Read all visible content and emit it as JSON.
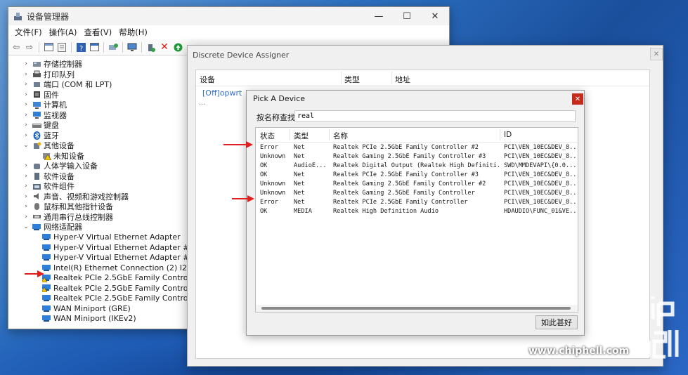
{
  "device_manager": {
    "title": "设备管理器",
    "menu": [
      "文件(F)",
      "操作(A)",
      "查看(V)",
      "帮助(H)"
    ],
    "tree": [
      {
        "label": "存储控制器",
        "arrow": ">",
        "level": 1,
        "icon": "storage-icon"
      },
      {
        "label": "打印队列",
        "arrow": ">",
        "level": 1,
        "icon": "printer-icon"
      },
      {
        "label": "端口 (COM 和 LPT)",
        "arrow": ">",
        "level": 1,
        "icon": "port-icon"
      },
      {
        "label": "固件",
        "arrow": ">",
        "level": 1,
        "icon": "firmware-icon"
      },
      {
        "label": "计算机",
        "arrow": ">",
        "level": 1,
        "icon": "computer-icon"
      },
      {
        "label": "监视器",
        "arrow": ">",
        "level": 1,
        "icon": "monitor-icon"
      },
      {
        "label": "键盘",
        "arrow": ">",
        "level": 1,
        "icon": "keyboard-icon"
      },
      {
        "label": "蓝牙",
        "arrow": ">",
        "level": 1,
        "icon": "bluetooth-icon"
      },
      {
        "label": "其他设备",
        "arrow": "v",
        "level": 1,
        "icon": "other-devices-icon"
      },
      {
        "label": "未知设备",
        "arrow": "",
        "level": 2,
        "icon": "unknown-device-warning-icon"
      },
      {
        "label": "人体学输入设备",
        "arrow": ">",
        "level": 1,
        "icon": "hid-icon"
      },
      {
        "label": "软件设备",
        "arrow": ">",
        "level": 1,
        "icon": "software-device-icon"
      },
      {
        "label": "软件组件",
        "arrow": ">",
        "level": 1,
        "icon": "software-component-icon"
      },
      {
        "label": "声音、视频和游戏控制器",
        "arrow": ">",
        "level": 1,
        "icon": "sound-icon"
      },
      {
        "label": "鼠标和其他指针设备",
        "arrow": ">",
        "level": 1,
        "icon": "mouse-icon"
      },
      {
        "label": "通用串行总线控制器",
        "arrow": ">",
        "level": 1,
        "icon": "usb-icon"
      },
      {
        "label": "网络适配器",
        "arrow": "v",
        "level": 1,
        "icon": "network-adapter-icon"
      },
      {
        "label": "Hyper-V Virtual Ethernet Adapter",
        "arrow": "",
        "level": 2,
        "icon": "network-adapter-icon"
      },
      {
        "label": "Hyper-V Virtual Ethernet Adapter #2",
        "arrow": "",
        "level": 2,
        "icon": "network-adapter-icon"
      },
      {
        "label": "Hyper-V Virtual Ethernet Adapter #3",
        "arrow": "",
        "level": 2,
        "icon": "network-adapter-icon"
      },
      {
        "label": "Intel(R) Ethernet Connection (2) I219-LM",
        "arrow": "",
        "level": 2,
        "icon": "network-adapter-icon"
      },
      {
        "label": "Realtek PCIe 2.5GbE Family Controller",
        "arrow": "",
        "level": 2,
        "icon": "network-adapter-warning-icon"
      },
      {
        "label": "Realtek PCIe 2.5GbE Family Controller #2",
        "arrow": "",
        "level": 2,
        "icon": "network-adapter-warning-icon"
      },
      {
        "label": "Realtek PCIe 2.5GbE Family Controller #3",
        "arrow": "",
        "level": 2,
        "icon": "network-adapter-icon"
      },
      {
        "label": "WAN Miniport (GRE)",
        "arrow": "",
        "level": 2,
        "icon": "network-adapter-icon"
      },
      {
        "label": "WAN Miniport (IKEv2)",
        "arrow": "",
        "level": 2,
        "icon": "network-adapter-icon"
      }
    ]
  },
  "dda": {
    "title": "Discrete Device Assigner",
    "columns": [
      "设备",
      "类型",
      "地址"
    ],
    "vm_item": "[Off]opwrt",
    "vm_sub": "..."
  },
  "pick": {
    "title": "Pick A Device",
    "search_label": "按名称查找",
    "search_value": "real",
    "columns": [
      "状态",
      "类型",
      "名称",
      "ID"
    ],
    "rows": [
      {
        "status": "Error",
        "type": "Net",
        "name": "Realtek PCIe 2.5GbE Family Controller #2",
        "id": "PCI\\VEN_10EC&DEV_8..."
      },
      {
        "status": "Unknown",
        "type": "Net",
        "name": "Realtek Gaming 2.5GbE Family Controller #3",
        "id": "PCI\\VEN_10EC&DEV_8..."
      },
      {
        "status": "OK",
        "type": "AudioE...",
        "name": "Realtek Digital Output (Realtek High Definiti...",
        "id": "SWD\\MMDEVAPI\\{0.0..."
      },
      {
        "status": "OK",
        "type": "Net",
        "name": "Realtek PCIe 2.5GbE Family Controller #3",
        "id": "PCI\\VEN_10EC&DEV_8..."
      },
      {
        "status": "Unknown",
        "type": "Net",
        "name": "Realtek Gaming 2.5GbE Family Controller #2",
        "id": "PCI\\VEN_10EC&DEV_8..."
      },
      {
        "status": "Unknown",
        "type": "Net",
        "name": "Realtek Gaming 2.5GbE Family Controller",
        "id": "PCI\\VEN_10EC&DEV_8..."
      },
      {
        "status": "Error",
        "type": "Net",
        "name": "Realtek PCIe 2.5GbE Family Controller",
        "id": "PCI\\VEN_10EC&DEV_8..."
      },
      {
        "status": "OK",
        "type": "MEDIA",
        "name": "Realtek High Definition Audio",
        "id": "HDAUDIO\\FUNC_01&VE..."
      }
    ],
    "ok_label": "如此甚好"
  },
  "watermark": {
    "url": "www.chiphell.com",
    "logo_text": "chip hell"
  },
  "colors": {
    "arrow_red": "#e02020",
    "link_blue": "#3470c9",
    "close_red": "#c42b1c"
  }
}
